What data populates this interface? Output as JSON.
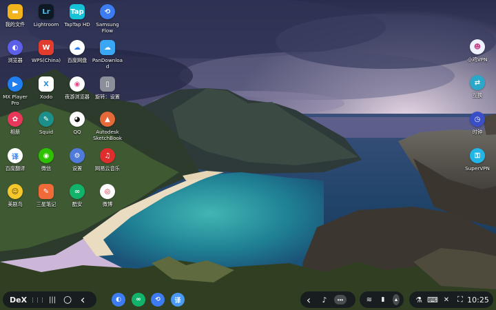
{
  "desktop": {
    "left_icons": [
      {
        "label": "我的文件",
        "icon": "folder-icon",
        "glyph": "▬",
        "color": "#f2b41c",
        "shape": "square"
      },
      {
        "label": "Lightroom",
        "icon": "lightroom-icon",
        "glyph": "Lr",
        "color": "#0d1a24",
        "shape": "square",
        "fg": "#4ec3f7"
      },
      {
        "label": "TapTap HD",
        "icon": "taptap-icon",
        "glyph": "Tap",
        "color": "#16c3d6",
        "shape": "square"
      },
      {
        "label": "Samsung\nFlow",
        "icon": "samsung-flow-icon",
        "glyph": "⟲",
        "color": "#3d7bf0",
        "shape": "round"
      },
      {
        "label": "浏览器",
        "icon": "browser-icon",
        "glyph": "◐",
        "color": "#5d5fe8",
        "shape": "round"
      },
      {
        "label": "WPS(China)",
        "icon": "wps-icon",
        "glyph": "W",
        "color": "#e23c2f",
        "shape": "square"
      },
      {
        "label": "百度网盘",
        "icon": "baidu-netdisk-icon",
        "glyph": "☁",
        "color": "#ffffff",
        "shape": "round",
        "fg": "#2d7ff9"
      },
      {
        "label": "PanDownloa\nd",
        "icon": "pandownload-icon",
        "glyph": "☁",
        "color": "#3aa7f5",
        "shape": "square"
      },
      {
        "label": "MX Player\nPro",
        "icon": "mx-player-icon",
        "glyph": "▶",
        "color": "#1f7ef0",
        "shape": "round"
      },
      {
        "label": "Xodo",
        "icon": "xodo-icon",
        "glyph": "X",
        "color": "#ffffff",
        "shape": "square",
        "fg": "#2d8fd5"
      },
      {
        "label": "夜游浏览器",
        "icon": "night-browser-icon",
        "glyph": "◉",
        "color": "#ffffff",
        "shape": "round",
        "fg": "#ea4c89"
      },
      {
        "label": "旋转：设置",
        "icon": "rotation-settings-icon",
        "glyph": "▯",
        "color": "#8a8f99",
        "shape": "square"
      },
      {
        "label": "相册",
        "icon": "gallery-icon",
        "glyph": "✿",
        "color": "#e8385a",
        "shape": "round"
      },
      {
        "label": "Squid",
        "icon": "squid-icon",
        "glyph": "✎",
        "color": "#1d8f8a",
        "shape": "round"
      },
      {
        "label": "QQ",
        "icon": "qq-icon",
        "glyph": "◕",
        "color": "#ffffff",
        "shape": "round",
        "fg": "#111111"
      },
      {
        "label": "Autodesk\nSketchBook",
        "icon": "sketchbook-icon",
        "glyph": "▲",
        "color": "#e56a3a",
        "shape": "round"
      },
      {
        "label": "百度翻译",
        "icon": "baidu-translate-icon",
        "glyph": "译",
        "color": "#ffffff",
        "shape": "round",
        "fg": "#2d7ff9"
      },
      {
        "label": "微信",
        "icon": "wechat-icon",
        "glyph": "◉",
        "color": "#2dc100",
        "shape": "round"
      },
      {
        "label": "设置",
        "icon": "settings-icon",
        "glyph": "⚙",
        "color": "#4f7ad9",
        "shape": "round"
      },
      {
        "label": "网易云音乐",
        "icon": "netease-music-icon",
        "glyph": "♫",
        "color": "#e02d2d",
        "shape": "round"
      },
      {
        "label": "美剧鸟",
        "icon": "meijuniao-icon",
        "glyph": "☺",
        "color": "#f5c72a",
        "shape": "round",
        "fg": "#4a3a10"
      },
      {
        "label": "三星笔记",
        "icon": "samsung-notes-icon",
        "glyph": "✎",
        "color": "#f06a3a",
        "shape": "square"
      },
      {
        "label": "酷安",
        "icon": "coolapk-icon",
        "glyph": "∞",
        "color": "#11b36a",
        "shape": "round"
      },
      {
        "label": "微博",
        "icon": "weibo-icon",
        "glyph": "◎",
        "color": "#ffffff",
        "shape": "round",
        "fg": "#e6162d"
      }
    ],
    "right_icons": [
      {
        "label": "小鸡VPN",
        "icon": "chicken-vpn-icon",
        "glyph": "☻",
        "color": "#eef2ff",
        "shape": "round",
        "fg": "#c8458a"
      },
      {
        "label": "互换",
        "icon": "swap-icon",
        "glyph": "⇄",
        "color": "#2aa7c9",
        "shape": "round"
      },
      {
        "label": "时钟",
        "icon": "clock-icon",
        "glyph": "◷",
        "color": "#3a4ec7",
        "shape": "round"
      },
      {
        "label": "SuperVPN",
        "icon": "supervpn-icon",
        "glyph": "⚿",
        "color": "#22b6e8",
        "shape": "round"
      }
    ]
  },
  "taskbar": {
    "dex_label": "DeX",
    "nav": [
      {
        "name": "apps-grid-icon",
        "glyph": "⋮⋮⋮"
      },
      {
        "name": "recent-apps-icon",
        "glyph": "|||"
      },
      {
        "name": "home-icon",
        "glyph": "○"
      },
      {
        "name": "back-icon",
        "glyph": "‹"
      }
    ],
    "pinned_apps": [
      {
        "name": "taskbar-browser-icon",
        "glyph": "◐",
        "color": "#3d7bf0"
      },
      {
        "name": "taskbar-coolapk-icon",
        "glyph": "∞",
        "color": "#11b36a"
      },
      {
        "name": "taskbar-samsung-flow-icon",
        "glyph": "⟲",
        "color": "#3d7bf0"
      },
      {
        "name": "taskbar-baidu-translate-icon",
        "glyph": "译",
        "color": "#4a9af5"
      }
    ],
    "notif_glyphs": {
      "collapse": "‹",
      "tiktok": "♪",
      "more": "•••"
    },
    "status_glyphs": {
      "wifi": "≋",
      "battery": "▮",
      "expand": "▲"
    },
    "tray_glyphs": {
      "lab": "⚗",
      "keyboard": "⌨",
      "mute": "✕",
      "screenshot": "⛶"
    },
    "clock": "10:25"
  }
}
